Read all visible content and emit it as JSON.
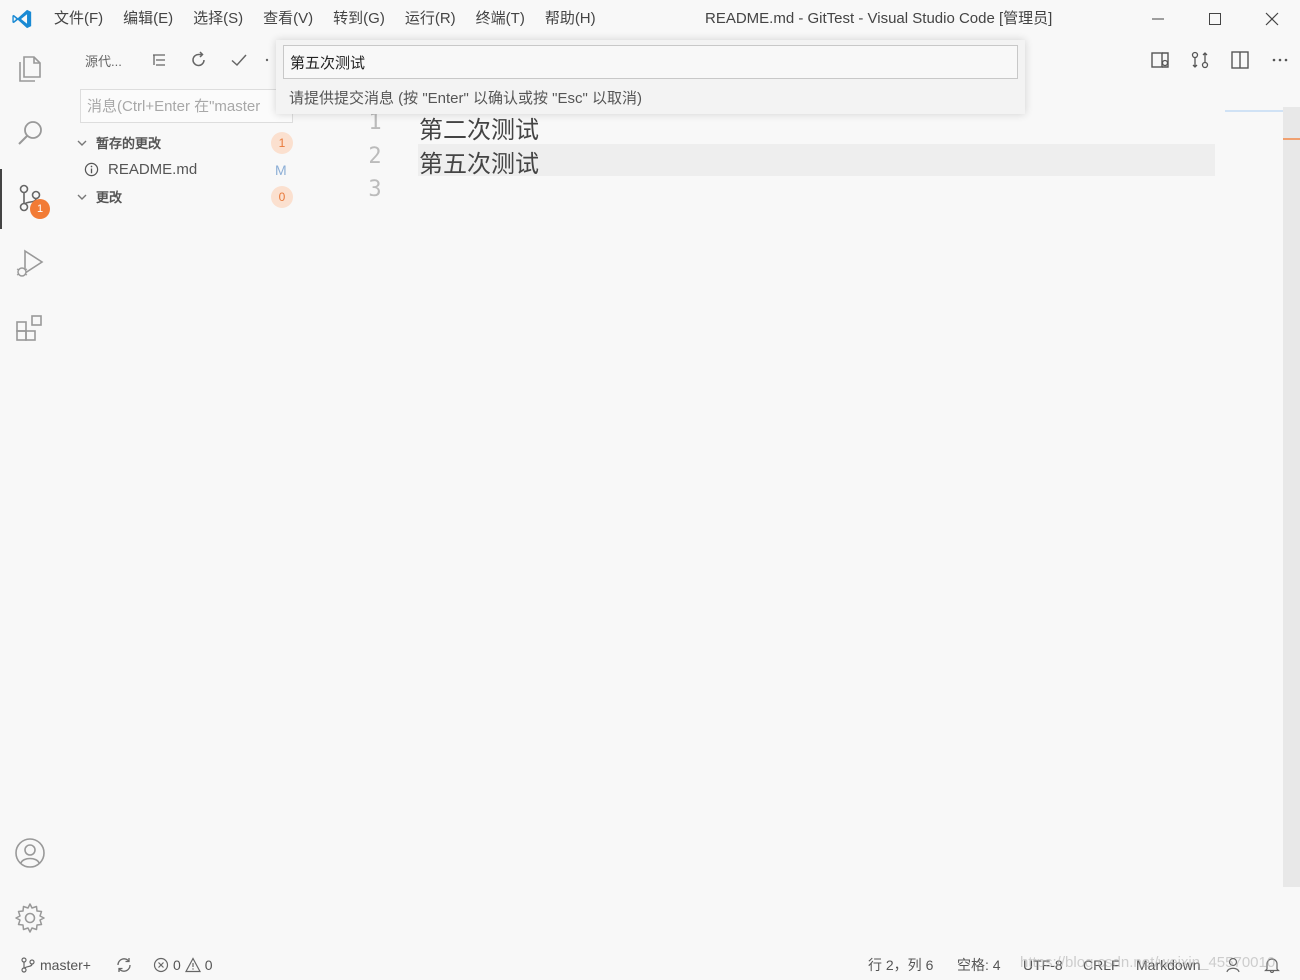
{
  "menubar": {
    "items": [
      "文件(F)",
      "编辑(E)",
      "选择(S)",
      "查看(V)",
      "转到(G)",
      "运行(R)",
      "终端(T)",
      "帮助(H)"
    ]
  },
  "window": {
    "title": "README.md - GitTest - Visual Studio Code [管理员]"
  },
  "activitybar": {
    "scm_badge": "1"
  },
  "sidebar": {
    "title": "源代...",
    "commit_placeholder": "消息(Ctrl+Enter 在\"master",
    "groups": [
      {
        "label": "暂存的更改",
        "count": "1"
      },
      {
        "label": "更改",
        "count": "0"
      }
    ],
    "staged_file": {
      "name": "README.md",
      "status": "M"
    }
  },
  "quick_input": {
    "value": "第五次测试",
    "message": "请提供提交消息 (按 \"Enter\" 以确认或按 \"Esc\" 以取消)"
  },
  "editor": {
    "lines": [
      {
        "num": "1",
        "text": "第二次测试"
      },
      {
        "num": "2",
        "text": "第五次测试"
      },
      {
        "num": "3",
        "text": ""
      }
    ]
  },
  "statusbar": {
    "branch": "master+",
    "errors": "0",
    "warnings": "0",
    "position": "行 2，列 6",
    "indent": "空格: 4",
    "encoding": "UTF-8",
    "eol": "CRLF",
    "language": "Markdown"
  },
  "watermark": "https://blog.csdn.net/weixin_45570010",
  "colors": {
    "badge": "#f27b35",
    "accent": "#007acc"
  }
}
